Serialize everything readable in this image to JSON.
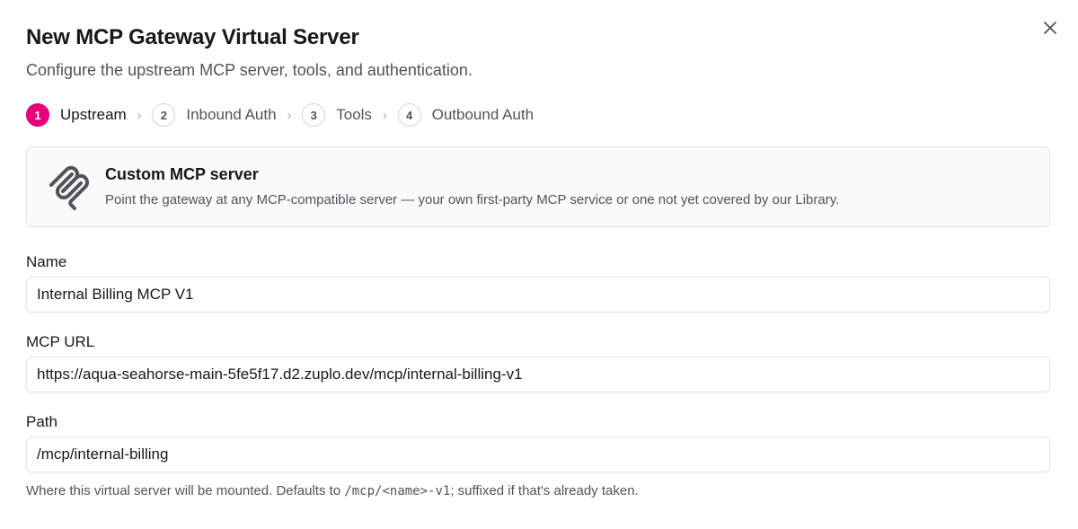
{
  "dialog": {
    "title": "New MCP Gateway Virtual Server",
    "subtitle": "Configure the upstream MCP server, tools, and authentication.",
    "close_icon": "close-icon"
  },
  "stepper": {
    "separator": "›",
    "active_color": "#e6007a",
    "steps": [
      {
        "number": "1",
        "label": "Upstream",
        "active": true
      },
      {
        "number": "2",
        "label": "Inbound Auth",
        "active": false
      },
      {
        "number": "3",
        "label": "Tools",
        "active": false
      },
      {
        "number": "4",
        "label": "Outbound Auth",
        "active": false
      }
    ]
  },
  "server_card": {
    "icon": "mcp-logo-icon",
    "title": "Custom MCP server",
    "description": "Point the gateway at any MCP-compatible server — your own first-party MCP service or one not yet covered by our Library."
  },
  "form": {
    "name": {
      "label": "Name",
      "value": "Internal Billing MCP V1"
    },
    "mcp_url": {
      "label": "MCP URL",
      "value": "https://aqua-seahorse-main-5fe5f17.d2.zuplo.dev/mcp/internal-billing-v1"
    },
    "path": {
      "label": "Path",
      "value": "/mcp/internal-billing"
    },
    "path_help": {
      "prefix": "Where this virtual server will be mounted. Defaults to ",
      "code": "/mcp/<name>-v1",
      "suffix": "; suffixed if that's already taken."
    }
  }
}
